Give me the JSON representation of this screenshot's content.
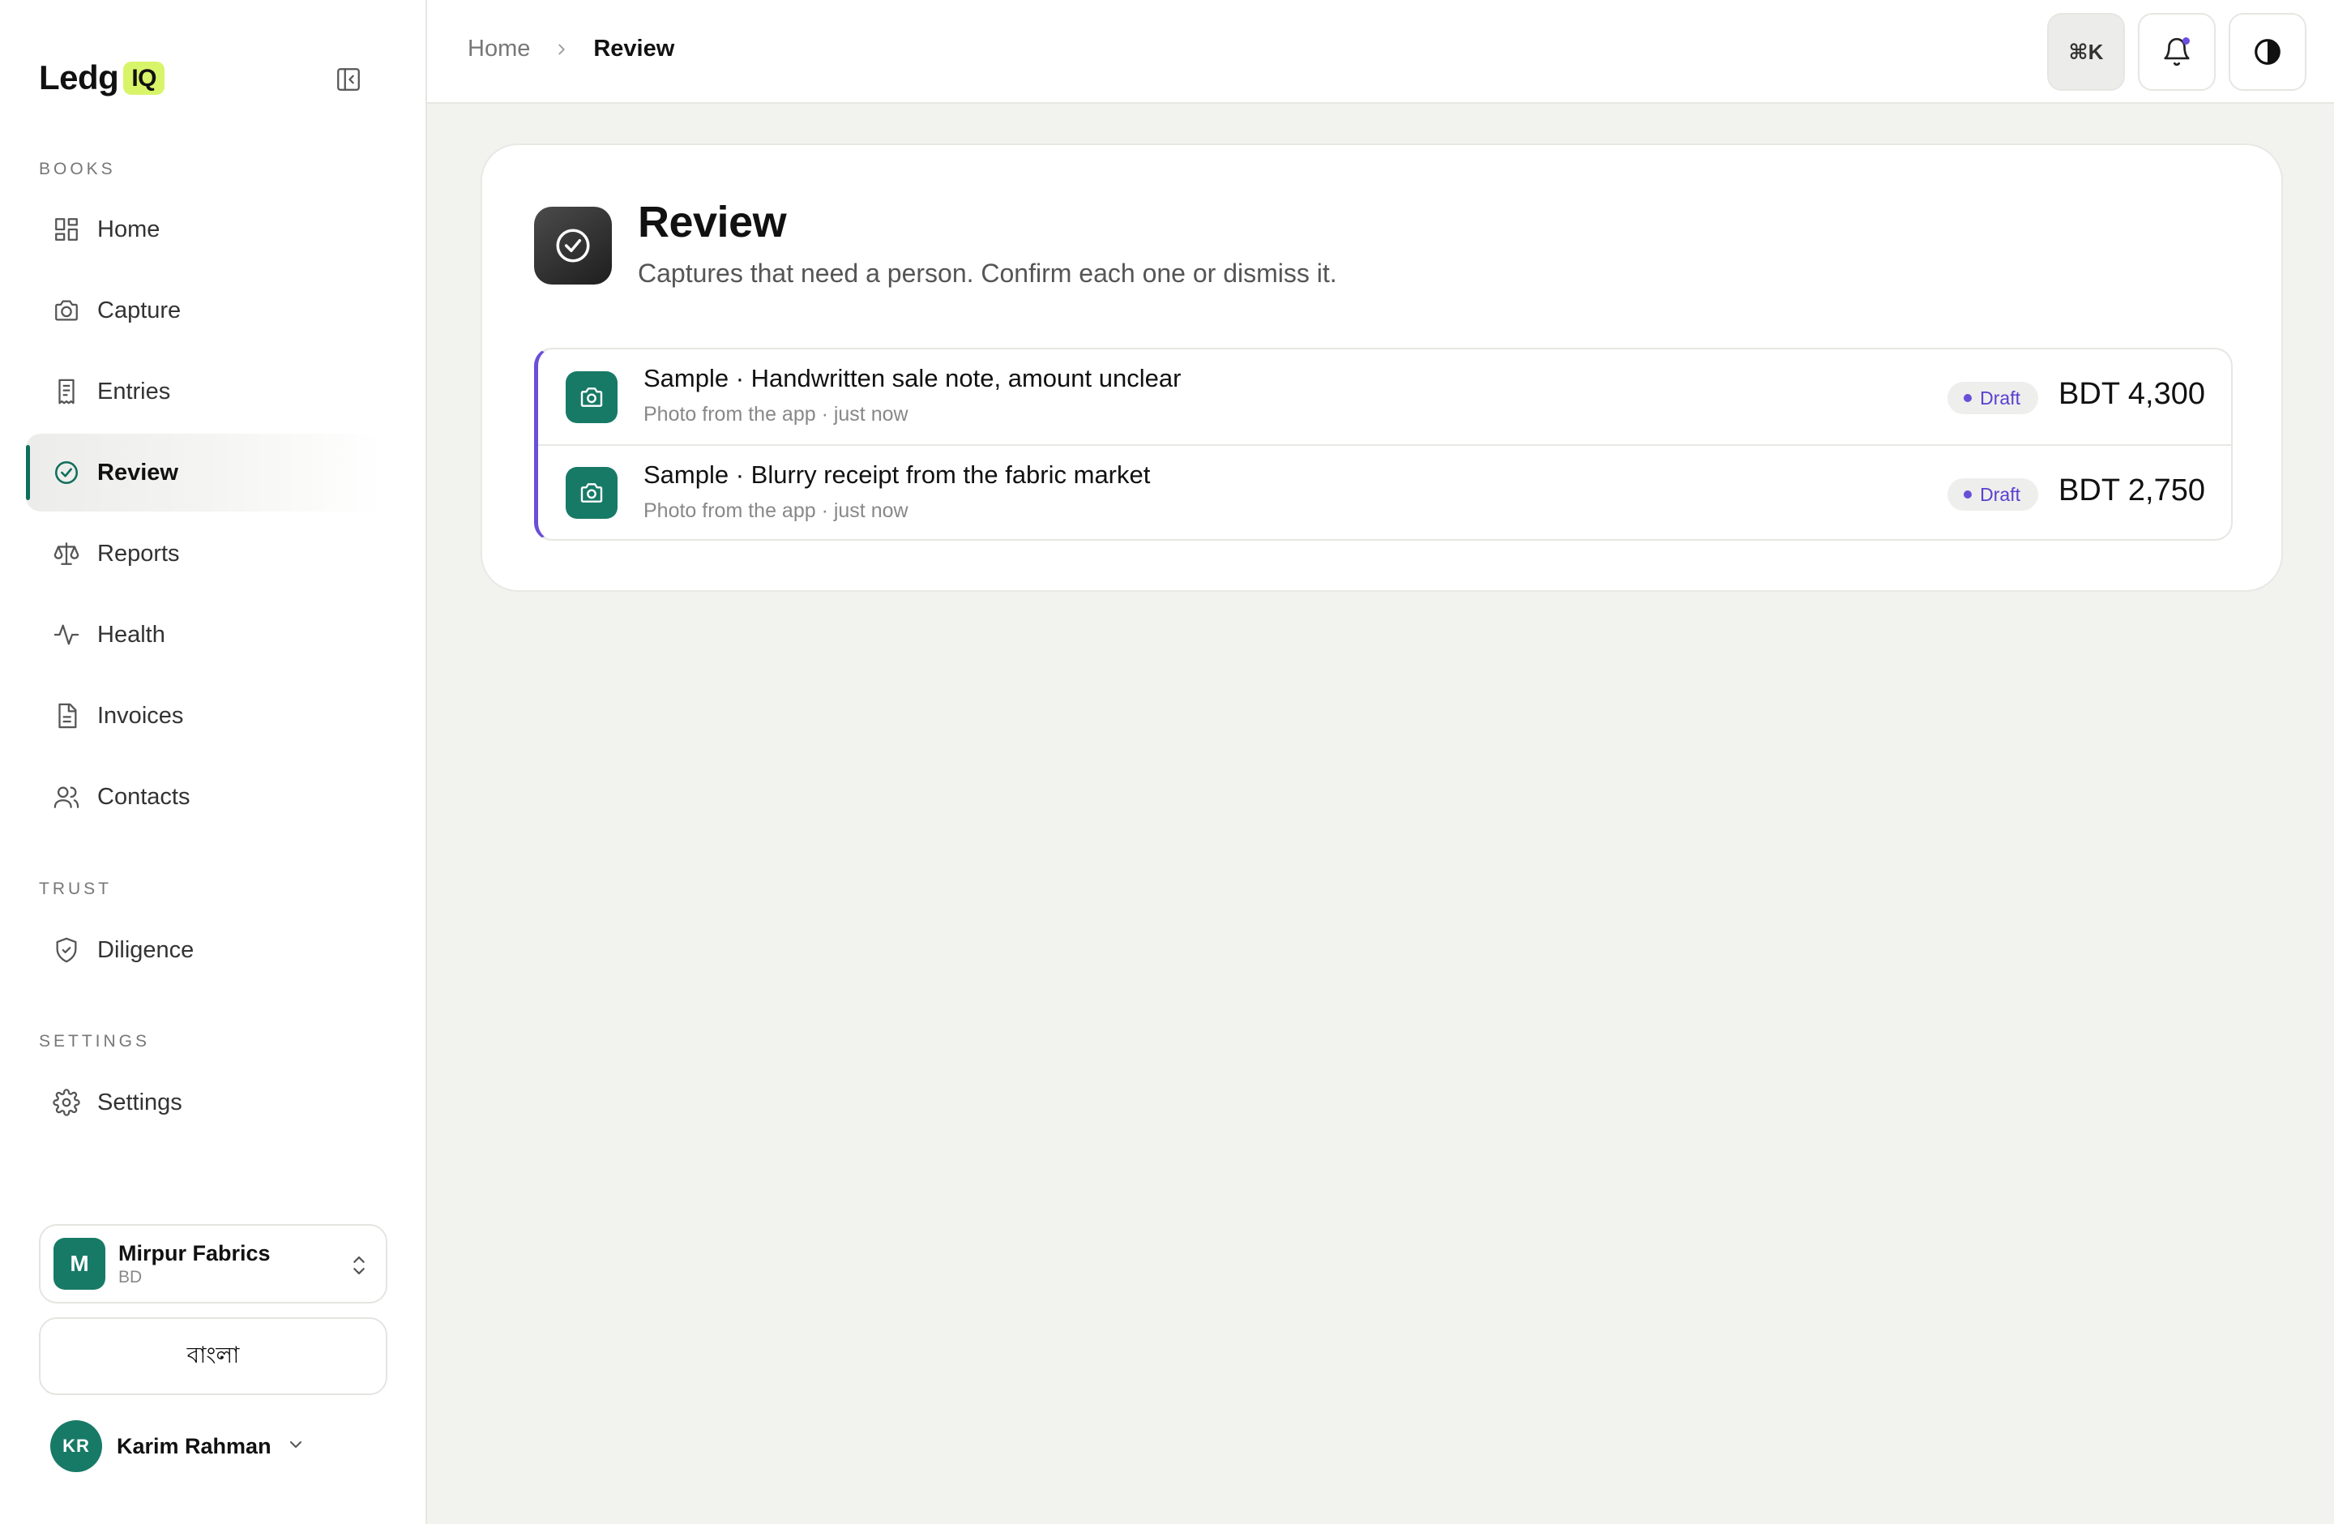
{
  "app": {
    "logo_text": "Ledg",
    "logo_badge": "IQ"
  },
  "sidebar": {
    "sections": {
      "books": "BOOKS",
      "trust": "TRUST",
      "settings": "SETTINGS"
    },
    "items": [
      {
        "label": "Home",
        "icon": "grid-icon"
      },
      {
        "label": "Capture",
        "icon": "camera-icon"
      },
      {
        "label": "Entries",
        "icon": "receipt-icon"
      },
      {
        "label": "Review",
        "icon": "check-circle-icon",
        "active": true
      },
      {
        "label": "Reports",
        "icon": "scale-icon"
      },
      {
        "label": "Health",
        "icon": "pulse-icon"
      },
      {
        "label": "Invoices",
        "icon": "document-icon"
      },
      {
        "label": "Contacts",
        "icon": "users-icon"
      },
      {
        "label": "Diligence",
        "icon": "shield-check-icon"
      },
      {
        "label": "Settings",
        "icon": "gear-icon"
      }
    ],
    "org": {
      "initial": "M",
      "name": "Mirpur Fabrics",
      "country": "BD"
    },
    "language_label": "বাংলা",
    "user": {
      "initials": "KR",
      "name": "Karim Rahman"
    }
  },
  "topbar": {
    "breadcrumb": {
      "home": "Home",
      "current": "Review"
    },
    "cmdk_label": "⌘K"
  },
  "review": {
    "title": "Review",
    "subtitle": "Captures that need a person. Confirm each one or dismiss it.",
    "items": [
      {
        "title": "Sample · Handwritten sale note, amount unclear",
        "meta": "Photo from the app · just now",
        "status": "Draft",
        "amount": "BDT 4,300"
      },
      {
        "title": "Sample · Blurry receipt from the fabric market",
        "meta": "Photo from the app · just now",
        "status": "Draft",
        "amount": "BDT 2,750"
      }
    ]
  },
  "colors": {
    "accent_green": "#177a66",
    "accent_purple": "#6a4fd8",
    "logo_lime": "#d8f56a"
  }
}
